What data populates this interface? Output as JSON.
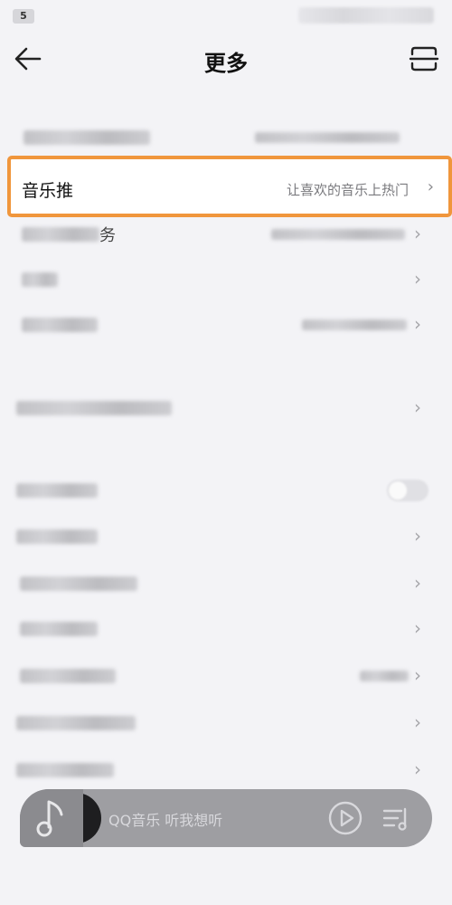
{
  "status_bar": {
    "sim_label": "5"
  },
  "header": {
    "title": "更多"
  },
  "highlight_item": {
    "label": "音乐推",
    "value": "让喜欢的音乐上热门"
  },
  "partial_items": {
    "service_suffix": "务"
  },
  "mini_player": {
    "text": "QQ音乐 听我想听"
  },
  "colors": {
    "highlight_border": "#f0963c",
    "background": "#f3f3f6",
    "player_bg": "#9e9ea2"
  },
  "icons": [
    "back-arrow-icon",
    "scan-icon",
    "chevron-right-icon",
    "music-note-icon",
    "play-icon",
    "playlist-icon"
  ]
}
